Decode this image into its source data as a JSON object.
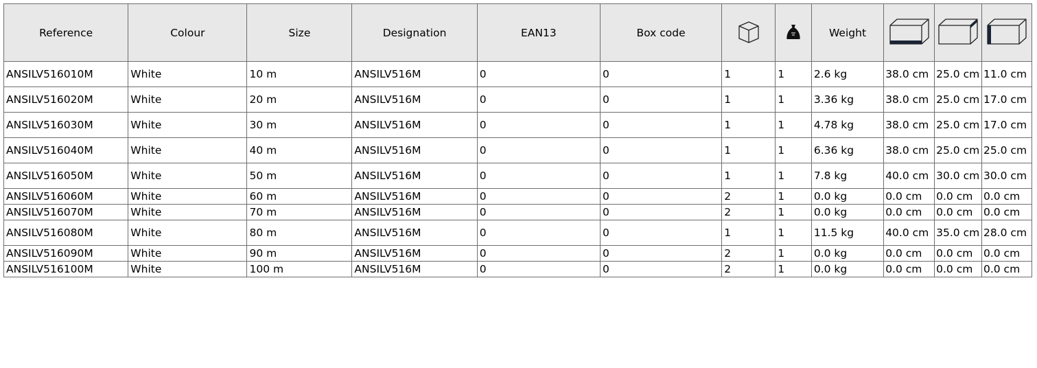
{
  "table": {
    "headers": {
      "reference": "Reference",
      "colour": "Colour",
      "size": "Size",
      "designation": "Designation",
      "ean13": "EAN13",
      "box_code": "Box code",
      "weight": "Weight"
    },
    "icons": {
      "box_quantity": "box-icon",
      "bag_quantity": "bag-icon",
      "length": "carton-length-icon",
      "width": "carton-width-icon",
      "height": "carton-height-icon"
    },
    "rows": [
      {
        "reference": "ANSILV516010M",
        "colour": "White",
        "size": "10 m",
        "designation": "ANSILV516M",
        "ean13": "0",
        "box_code": "0",
        "box_qty": "1",
        "bag_qty": "1",
        "weight": "2.6 kg",
        "length": "38.0 cm",
        "width": "25.0 cm",
        "height": "11.0 cm",
        "tall": true
      },
      {
        "reference": "ANSILV516020M",
        "colour": "White",
        "size": "20 m",
        "designation": "ANSILV516M",
        "ean13": "0",
        "box_code": "0",
        "box_qty": "1",
        "bag_qty": "1",
        "weight": "3.36 kg",
        "length": "38.0 cm",
        "width": "25.0 cm",
        "height": "17.0 cm",
        "tall": true
      },
      {
        "reference": "ANSILV516030M",
        "colour": "White",
        "size": "30 m",
        "designation": "ANSILV516M",
        "ean13": "0",
        "box_code": "0",
        "box_qty": "1",
        "bag_qty": "1",
        "weight": "4.78 kg",
        "length": "38.0 cm",
        "width": "25.0 cm",
        "height": "17.0 cm",
        "tall": true
      },
      {
        "reference": "ANSILV516040M",
        "colour": "White",
        "size": "40 m",
        "designation": "ANSILV516M",
        "ean13": "0",
        "box_code": "0",
        "box_qty": "1",
        "bag_qty": "1",
        "weight": "6.36 kg",
        "length": "38.0 cm",
        "width": "25.0 cm",
        "height": "25.0 cm",
        "tall": true
      },
      {
        "reference": "ANSILV516050M",
        "colour": "White",
        "size": "50 m",
        "designation": "ANSILV516M",
        "ean13": "0",
        "box_code": "0",
        "box_qty": "1",
        "bag_qty": "1",
        "weight": "7.8 kg",
        "length": "40.0 cm",
        "width": "30.0 cm",
        "height": "30.0 cm",
        "tall": true
      },
      {
        "reference": "ANSILV516060M",
        "colour": "White",
        "size": "60 m",
        "designation": "ANSILV516M",
        "ean13": "0",
        "box_code": "0",
        "box_qty": "2",
        "bag_qty": "1",
        "weight": "0.0 kg",
        "length": "0.0 cm",
        "width": "0.0 cm",
        "height": "0.0 cm",
        "tall": false
      },
      {
        "reference": "ANSILV516070M",
        "colour": "White",
        "size": "70 m",
        "designation": "ANSILV516M",
        "ean13": "0",
        "box_code": "0",
        "box_qty": "2",
        "bag_qty": "1",
        "weight": "0.0 kg",
        "length": "0.0 cm",
        "width": "0.0 cm",
        "height": "0.0 cm",
        "tall": false
      },
      {
        "reference": "ANSILV516080M",
        "colour": "White",
        "size": "80 m",
        "designation": "ANSILV516M",
        "ean13": "0",
        "box_code": "0",
        "box_qty": "1",
        "bag_qty": "1",
        "weight": "11.5 kg",
        "length": "40.0 cm",
        "width": "35.0 cm",
        "height": "28.0 cm",
        "tall": true
      },
      {
        "reference": "ANSILV516090M",
        "colour": "White",
        "size": "90 m",
        "designation": "ANSILV516M",
        "ean13": "0",
        "box_code": "0",
        "box_qty": "2",
        "bag_qty": "1",
        "weight": "0.0 kg",
        "length": "0.0 cm",
        "width": "0.0 cm",
        "height": "0.0 cm",
        "tall": false
      },
      {
        "reference": "ANSILV516100M",
        "colour": "White",
        "size": "100 m",
        "designation": "ANSILV516M",
        "ean13": "0",
        "box_code": "0",
        "box_qty": "2",
        "bag_qty": "1",
        "weight": "0.0 kg",
        "length": "0.0 cm",
        "width": "0.0 cm",
        "height": "0.0 cm",
        "tall": false
      }
    ]
  }
}
